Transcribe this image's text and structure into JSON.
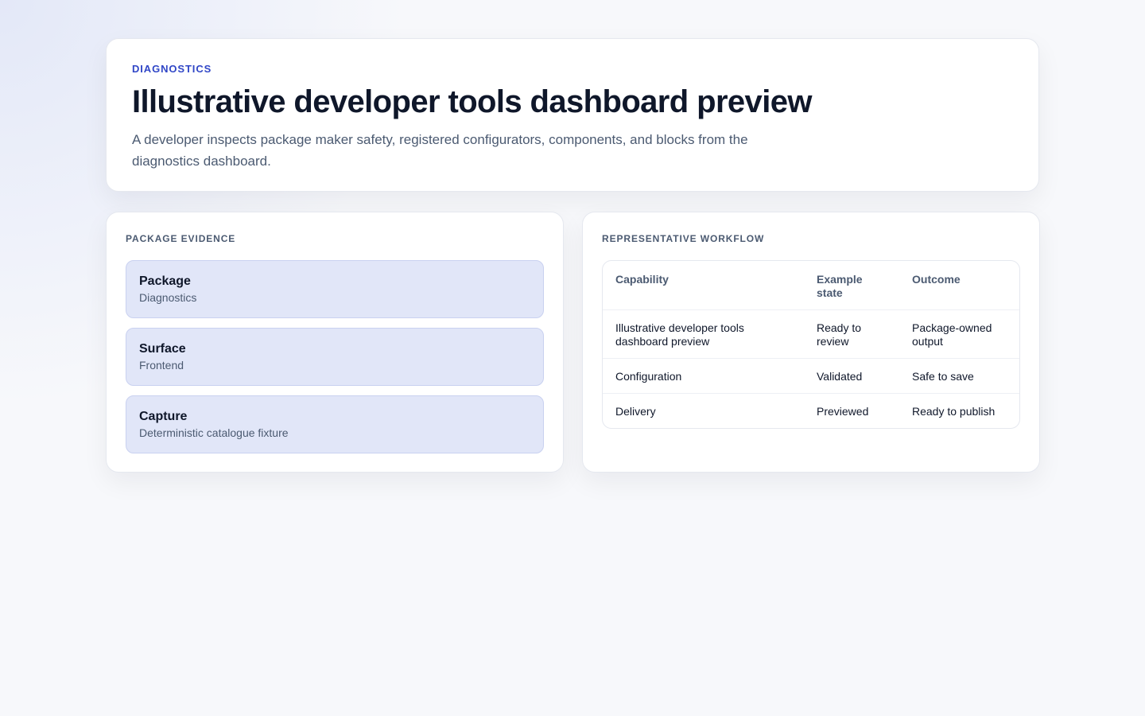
{
  "hero": {
    "eyebrow": "DIAGNOSTICS",
    "title": "Illustrative developer tools dashboard preview",
    "description": "A developer inspects package maker safety, registered configurators, components, and blocks from the diagnostics dashboard."
  },
  "evidence": {
    "label": "PACKAGE EVIDENCE",
    "items": [
      {
        "title": "Package",
        "value": "Diagnostics"
      },
      {
        "title": "Surface",
        "value": "Frontend"
      },
      {
        "title": "Capture",
        "value": "Deterministic catalogue fixture"
      }
    ]
  },
  "workflow": {
    "label": "REPRESENTATIVE WORKFLOW",
    "columns": [
      "Capability",
      "Example state",
      "Outcome"
    ],
    "rows": [
      [
        "Illustrative developer tools dashboard preview",
        "Ready to review",
        "Package-owned output"
      ],
      [
        "Configuration",
        "Validated",
        "Safe to save"
      ],
      [
        "Delivery",
        "Previewed",
        "Ready to publish"
      ]
    ]
  },
  "colors": {
    "accent": "#3147c7",
    "evidence_bg": "#e1e6f8",
    "text_primary": "#0f172a",
    "text_muted": "#4b5a71"
  }
}
